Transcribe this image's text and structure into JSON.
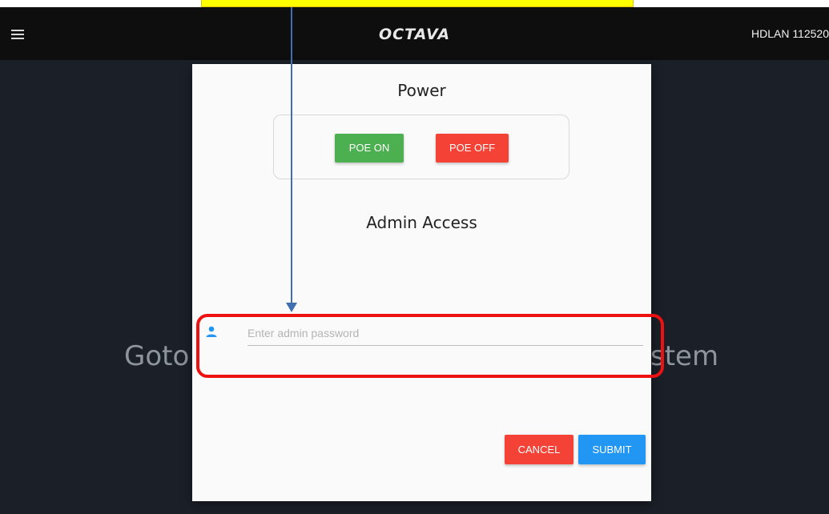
{
  "topbar": {
    "logo": "OCTAVA",
    "device_name": "HDLAN 112520"
  },
  "background_text": {
    "left": "Goto",
    "right": "stem"
  },
  "modal": {
    "power_title": "Power",
    "poe_on_label": "POE ON",
    "poe_off_label": "POE OFF",
    "admin_title": "Admin Access",
    "password_placeholder": "Enter admin password",
    "password_value": "",
    "cancel_label": "CANCEL",
    "submit_label": "SUBMIT"
  },
  "colors": {
    "poe_on": "#4caf50",
    "poe_off": "#f44336",
    "cancel": "#f44336",
    "submit": "#2196f3",
    "user_icon": "#2196f3",
    "annotation_highlight": "#ee1111",
    "annotation_arrow": "#3f6fb0",
    "callout_fill": "#ffff00"
  },
  "icons": {
    "menu": "menu-icon",
    "user": "user-icon"
  }
}
